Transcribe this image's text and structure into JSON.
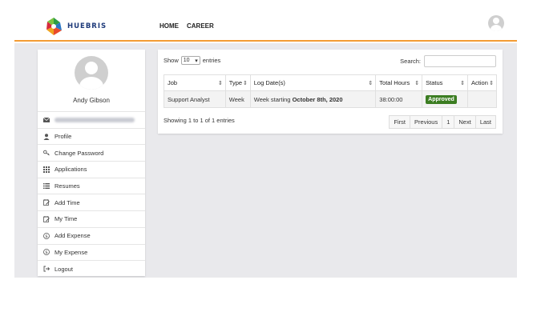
{
  "brand": {
    "name": "HUEBRIS"
  },
  "nav": {
    "home": "HOME",
    "career": "CAREER"
  },
  "profile": {
    "name": "Andy Gibson"
  },
  "sidebar": {
    "items": [
      {
        "label": "Profile",
        "icon": "user-icon"
      },
      {
        "label": "Change Password",
        "icon": "key-icon"
      },
      {
        "label": "Applications",
        "icon": "grid-icon"
      },
      {
        "label": "Resumes",
        "icon": "list-icon"
      },
      {
        "label": "Add Time",
        "icon": "calendar-edit-icon"
      },
      {
        "label": "My Time",
        "icon": "calendar-edit-icon"
      },
      {
        "label": "Add Expense",
        "icon": "dollar-circle-icon"
      },
      {
        "label": "My Expense",
        "icon": "dollar-circle-icon"
      },
      {
        "label": "Logout",
        "icon": "logout-icon"
      }
    ]
  },
  "table_controls": {
    "show_label": "Show",
    "page_size": "10",
    "entries_label": "entries",
    "search_label": "Search:",
    "search_value": ""
  },
  "table": {
    "columns": [
      "Job",
      "Type",
      "Log Date(s)",
      "Total Hours",
      "Status",
      "Action"
    ],
    "rows": [
      {
        "job": "Support Analyst",
        "type": "Week",
        "log_prefix": "Week starting ",
        "log_date": "October 8th, 2020",
        "total_hours": "38:00:00",
        "status": "Approved",
        "action": ""
      }
    ]
  },
  "footer": {
    "showing": "Showing 1 to 1 of 1 entries"
  },
  "pager": {
    "first": "First",
    "previous": "Previous",
    "page": "1",
    "next": "Next",
    "last": "Last"
  },
  "colors": {
    "accent": "#f39c34",
    "approved": "#3c7d22",
    "background": "#e9e9ec"
  }
}
